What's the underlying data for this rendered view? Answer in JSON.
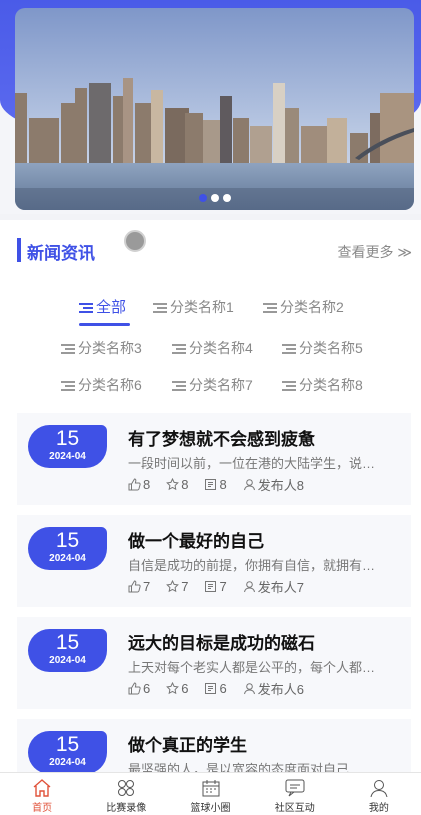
{
  "banner": {
    "dots": 3,
    "active_dot": 0
  },
  "section": {
    "title": "新闻资讯",
    "more": "查看更多 ≫"
  },
  "tabs": [
    "全部",
    "分类名称1",
    "分类名称2",
    "分类名称3",
    "分类名称4",
    "分类名称5",
    "分类名称6",
    "分类名称7",
    "分类名称8"
  ],
  "news": [
    {
      "day": "15",
      "ym": "2024-04",
      "title": "有了梦想就不会感到疲惫",
      "summary": "一段时间以前，一位在港的大陆学生，说起…",
      "likes": "8",
      "stars": "8",
      "views": "8",
      "author": "发布人8"
    },
    {
      "day": "15",
      "ym": "2024-04",
      "title": "做一个最好的自己",
      "summary": "自信是成功的前提，你拥有自信，就拥有了…",
      "likes": "7",
      "stars": "7",
      "views": "7",
      "author": "发布人7"
    },
    {
      "day": "15",
      "ym": "2024-04",
      "title": "远大的目标是成功的磁石",
      "summary": "上天对每个老实人都是公平的，每个人都有…",
      "likes": "6",
      "stars": "6",
      "views": "6",
      "author": "发布人6"
    },
    {
      "day": "15",
      "ym": "2024-04",
      "title": "做个真正的学生",
      "summary": "最坚强的人，是以宽容的态度面对自己…",
      "likes": "",
      "stars": "",
      "views": "",
      "author": ""
    }
  ],
  "tabbar": [
    {
      "label": "首页",
      "icon": "home-icon",
      "active": true
    },
    {
      "label": "比赛录像",
      "icon": "grid-icon",
      "active": false
    },
    {
      "label": "篮球小圈",
      "icon": "calendar-icon",
      "active": false
    },
    {
      "label": "社区互动",
      "icon": "chat-icon",
      "active": false
    },
    {
      "label": "我的",
      "icon": "user-icon",
      "active": false
    }
  ],
  "colors": {
    "accent": "#3f51e6",
    "active_tab": "#e0523a"
  }
}
